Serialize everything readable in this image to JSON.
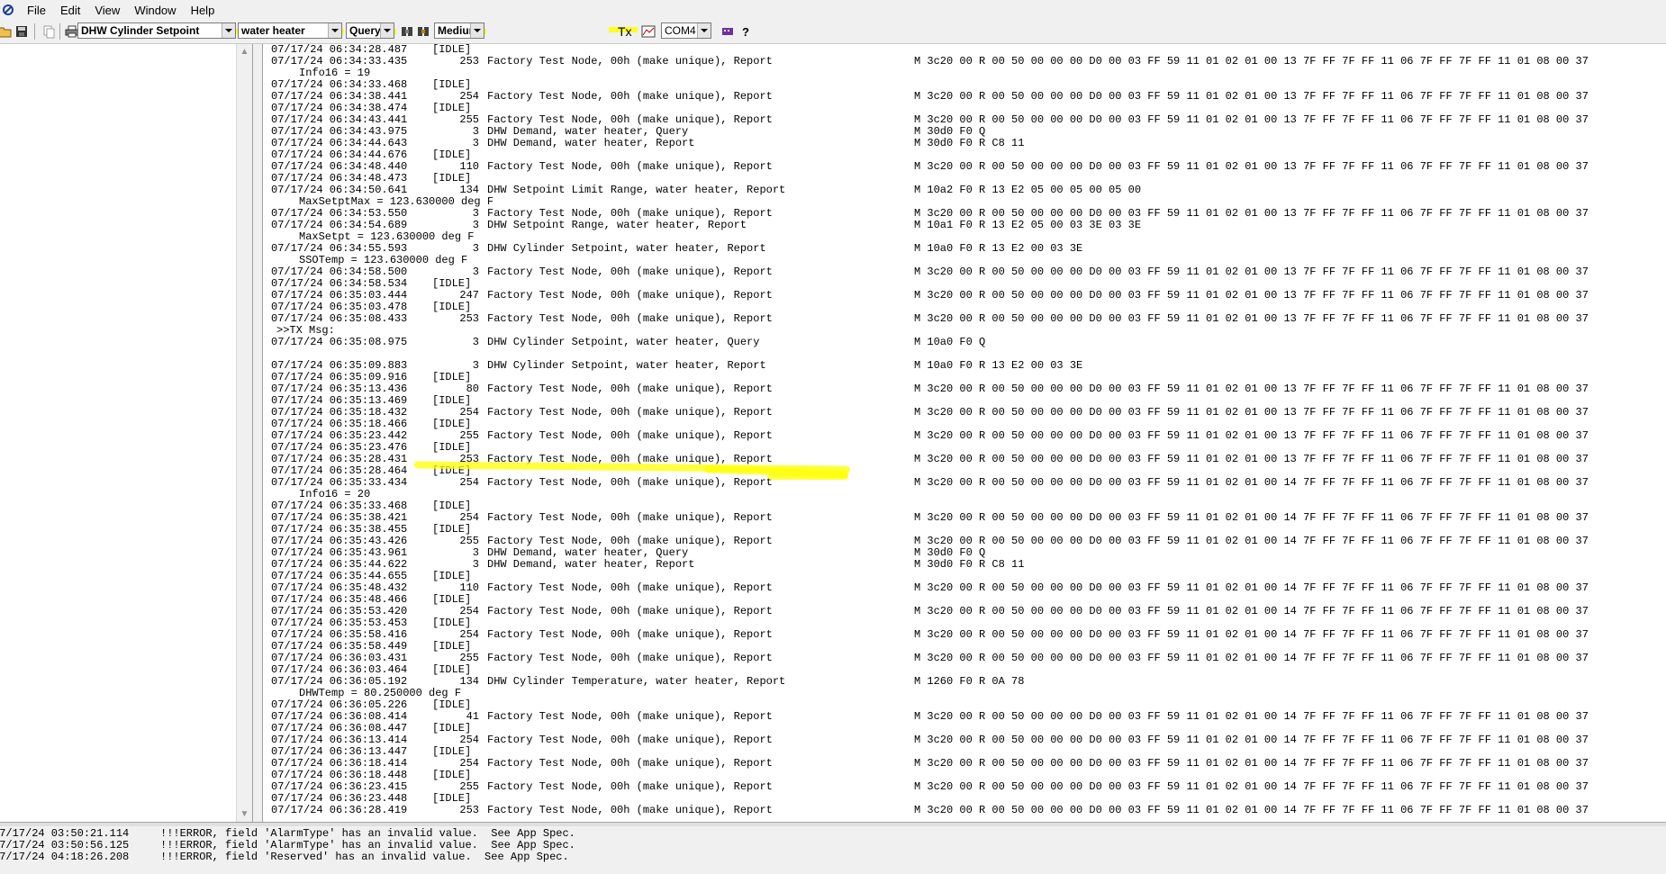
{
  "menu": [
    "File",
    "Edit",
    "View",
    "Window",
    "Help"
  ],
  "toolbar": {
    "combo_message": "DHW Cylinder Setpoint",
    "combo_device": "water heater",
    "combo_type": "Query",
    "combo_priority": "Medium",
    "tx_label": "Tx",
    "port": "COM4"
  },
  "log_lines": [
    {
      "ts": "07/17/24 06:34:28.487",
      "num": "",
      "desc": "[IDLE]",
      "hex": ""
    },
    {
      "ts": "07/17/24 06:34:33.435",
      "num": "253",
      "desc": "Factory Test Node, 00h (make unique), Report",
      "hex": "M 3c20 00 R 00 50 00 00 00 D0 00 03 FF 59 11 01 02 01 00 13 7F FF 7F FF 11 06 7F FF 7F FF 11 01 08 00 37"
    },
    {
      "sub": "Info16 = 19"
    },
    {
      "ts": "07/17/24 06:34:33.468",
      "num": "",
      "desc": "[IDLE]",
      "hex": ""
    },
    {
      "ts": "07/17/24 06:34:38.441",
      "num": "254",
      "desc": "Factory Test Node, 00h (make unique), Report",
      "hex": "M 3c20 00 R 00 50 00 00 00 D0 00 03 FF 59 11 01 02 01 00 13 7F FF 7F FF 11 06 7F FF 7F FF 11 01 08 00 37"
    },
    {
      "ts": "07/17/24 06:34:38.474",
      "num": "",
      "desc": "[IDLE]",
      "hex": ""
    },
    {
      "ts": "07/17/24 06:34:43.441",
      "num": "255",
      "desc": "Factory Test Node, 00h (make unique), Report",
      "hex": "M 3c20 00 R 00 50 00 00 00 D0 00 03 FF 59 11 01 02 01 00 13 7F FF 7F FF 11 06 7F FF 7F FF 11 01 08 00 37"
    },
    {
      "ts": "07/17/24 06:34:43.975",
      "num": "3",
      "desc": "DHW Demand, water heater, Query",
      "hex": "M 30d0 F0 Q"
    },
    {
      "ts": "07/17/24 06:34:44.643",
      "num": "3",
      "desc": "DHW Demand, water heater, Report",
      "hex": "M 30d0 F0 R C8 11"
    },
    {
      "ts": "07/17/24 06:34:44.676",
      "num": "",
      "desc": "[IDLE]",
      "hex": ""
    },
    {
      "ts": "07/17/24 06:34:48.440",
      "num": "110",
      "desc": "Factory Test Node, 00h (make unique), Report",
      "hex": "M 3c20 00 R 00 50 00 00 00 D0 00 03 FF 59 11 01 02 01 00 13 7F FF 7F FF 11 06 7F FF 7F FF 11 01 08 00 37"
    },
    {
      "ts": "07/17/24 06:34:48.473",
      "num": "",
      "desc": "[IDLE]",
      "hex": ""
    },
    {
      "ts": "07/17/24 06:34:50.641",
      "num": "134",
      "desc": "DHW Setpoint Limit Range, water heater, Report",
      "hex": "M 10a2 F0 R 13 E2 05 00 05 00 05 00"
    },
    {
      "sub": "MaxSetptMax = 123.630000 deg F"
    },
    {
      "ts": "07/17/24 06:34:53.550",
      "num": "3",
      "desc": "Factory Test Node, 00h (make unique), Report",
      "hex": "M 3c20 00 R 00 50 00 00 00 D0 00 03 FF 59 11 01 02 01 00 13 7F FF 7F FF 11 06 7F FF 7F FF 11 01 08 00 37"
    },
    {
      "ts": "07/17/24 06:34:54.689",
      "num": "3",
      "desc": "DHW Setpoint Range, water heater, Report",
      "hex": "M 10a1 F0 R 13 E2 05 00 03 3E 03 3E"
    },
    {
      "sub": "MaxSetpt = 123.630000 deg F"
    },
    {
      "ts": "07/17/24 06:34:55.593",
      "num": "3",
      "desc": "DHW Cylinder Setpoint, water heater, Report",
      "hex": "M 10a0 F0 R 13 E2 00 03 3E"
    },
    {
      "sub": "SSOTemp = 123.630000 deg F"
    },
    {
      "ts": "07/17/24 06:34:58.500",
      "num": "3",
      "desc": "Factory Test Node, 00h (make unique), Report",
      "hex": "M 3c20 00 R 00 50 00 00 00 D0 00 03 FF 59 11 01 02 01 00 13 7F FF 7F FF 11 06 7F FF 7F FF 11 01 08 00 37"
    },
    {
      "ts": "07/17/24 06:34:58.534",
      "num": "",
      "desc": "[IDLE]",
      "hex": ""
    },
    {
      "ts": "07/17/24 06:35:03.444",
      "num": "247",
      "desc": "Factory Test Node, 00h (make unique), Report",
      "hex": "M 3c20 00 R 00 50 00 00 00 D0 00 03 FF 59 11 01 02 01 00 13 7F FF 7F FF 11 06 7F FF 7F FF 11 01 08 00 37"
    },
    {
      "ts": "07/17/24 06:35:03.478",
      "num": "",
      "desc": "[IDLE]",
      "hex": ""
    },
    {
      "ts": "07/17/24 06:35:08.433",
      "num": "253",
      "desc": "Factory Test Node, 00h (make unique), Report",
      "hex": "M 3c20 00 R 00 50 00 00 00 D0 00 03 FF 59 11 01 02 01 00 13 7F FF 7F FF 11 06 7F FF 7F FF 11 01 08 00 37"
    },
    {
      "msg": ">>TX Msg:"
    },
    {
      "ts": "07/17/24 06:35:08.975",
      "num": "3",
      "desc": "DHW Cylinder Setpoint, water heater, Query",
      "hex": "M 10a0 F0 Q"
    },
    {
      "blank": true
    },
    {
      "ts": "07/17/24 06:35:09.883",
      "num": "3",
      "desc": "DHW Cylinder Setpoint, water heater, Report",
      "hex": "M 10a0 F0 R 13 E2 00 03 3E"
    },
    {
      "ts": "07/17/24 06:35:09.916",
      "num": "",
      "desc": "[IDLE]",
      "hex": ""
    },
    {
      "ts": "07/17/24 06:35:13.436",
      "num": "80",
      "desc": "Factory Test Node, 00h (make unique), Report",
      "hex": "M 3c20 00 R 00 50 00 00 00 D0 00 03 FF 59 11 01 02 01 00 13 7F FF 7F FF 11 06 7F FF 7F FF 11 01 08 00 37"
    },
    {
      "ts": "07/17/24 06:35:13.469",
      "num": "",
      "desc": "[IDLE]",
      "hex": ""
    },
    {
      "ts": "07/17/24 06:35:18.432",
      "num": "254",
      "desc": "Factory Test Node, 00h (make unique), Report",
      "hex": "M 3c20 00 R 00 50 00 00 00 D0 00 03 FF 59 11 01 02 01 00 13 7F FF 7F FF 11 06 7F FF 7F FF 11 01 08 00 37"
    },
    {
      "ts": "07/17/24 06:35:18.466",
      "num": "",
      "desc": "[IDLE]",
      "hex": ""
    },
    {
      "ts": "07/17/24 06:35:23.442",
      "num": "255",
      "desc": "Factory Test Node, 00h (make unique), Report",
      "hex": "M 3c20 00 R 00 50 00 00 00 D0 00 03 FF 59 11 01 02 01 00 13 7F FF 7F FF 11 06 7F FF 7F FF 11 01 08 00 37"
    },
    {
      "ts": "07/17/24 06:35:23.476",
      "num": "",
      "desc": "[IDLE]",
      "hex": ""
    },
    {
      "ts": "07/17/24 06:35:28.431",
      "num": "253",
      "desc": "Factory Test Node, 00h (make unique), Report",
      "hex": "M 3c20 00 R 00 50 00 00 00 D0 00 03 FF 59 11 01 02 01 00 13 7F FF 7F FF 11 06 7F FF 7F FF 11 01 08 00 37"
    },
    {
      "ts": "07/17/24 06:35:28.464",
      "num": "",
      "desc": "[IDLE]",
      "hex": ""
    },
    {
      "ts": "07/17/24 06:35:33.434",
      "num": "254",
      "desc": "Factory Test Node, 00h (make unique), Report",
      "hex": "M 3c20 00 R 00 50 00 00 00 D0 00 03 FF 59 11 01 02 01 00 14 7F FF 7F FF 11 06 7F FF 7F FF 11 01 08 00 37"
    },
    {
      "sub": "Info16 = 20"
    },
    {
      "ts": "07/17/24 06:35:33.468",
      "num": "",
      "desc": "[IDLE]",
      "hex": ""
    },
    {
      "ts": "07/17/24 06:35:38.421",
      "num": "254",
      "desc": "Factory Test Node, 00h (make unique), Report",
      "hex": "M 3c20 00 R 00 50 00 00 00 D0 00 03 FF 59 11 01 02 01 00 14 7F FF 7F FF 11 06 7F FF 7F FF 11 01 08 00 37"
    },
    {
      "ts": "07/17/24 06:35:38.455",
      "num": "",
      "desc": "[IDLE]",
      "hex": ""
    },
    {
      "ts": "07/17/24 06:35:43.426",
      "num": "255",
      "desc": "Factory Test Node, 00h (make unique), Report",
      "hex": "M 3c20 00 R 00 50 00 00 00 D0 00 03 FF 59 11 01 02 01 00 14 7F FF 7F FF 11 06 7F FF 7F FF 11 01 08 00 37"
    },
    {
      "ts": "07/17/24 06:35:43.961",
      "num": "3",
      "desc": "DHW Demand, water heater, Query",
      "hex": "M 30d0 F0 Q"
    },
    {
      "ts": "07/17/24 06:35:44.622",
      "num": "3",
      "desc": "DHW Demand, water heater, Report",
      "hex": "M 30d0 F0 R C8 11"
    },
    {
      "ts": "07/17/24 06:35:44.655",
      "num": "",
      "desc": "[IDLE]",
      "hex": ""
    },
    {
      "ts": "07/17/24 06:35:48.432",
      "num": "110",
      "desc": "Factory Test Node, 00h (make unique), Report",
      "hex": "M 3c20 00 R 00 50 00 00 00 D0 00 03 FF 59 11 01 02 01 00 14 7F FF 7F FF 11 06 7F FF 7F FF 11 01 08 00 37"
    },
    {
      "ts": "07/17/24 06:35:48.466",
      "num": "",
      "desc": "[IDLE]",
      "hex": ""
    },
    {
      "ts": "07/17/24 06:35:53.420",
      "num": "254",
      "desc": "Factory Test Node, 00h (make unique), Report",
      "hex": "M 3c20 00 R 00 50 00 00 00 D0 00 03 FF 59 11 01 02 01 00 14 7F FF 7F FF 11 06 7F FF 7F FF 11 01 08 00 37"
    },
    {
      "ts": "07/17/24 06:35:53.453",
      "num": "",
      "desc": "[IDLE]",
      "hex": ""
    },
    {
      "ts": "07/17/24 06:35:58.416",
      "num": "254",
      "desc": "Factory Test Node, 00h (make unique), Report",
      "hex": "M 3c20 00 R 00 50 00 00 00 D0 00 03 FF 59 11 01 02 01 00 14 7F FF 7F FF 11 06 7F FF 7F FF 11 01 08 00 37"
    },
    {
      "ts": "07/17/24 06:35:58.449",
      "num": "",
      "desc": "[IDLE]",
      "hex": ""
    },
    {
      "ts": "07/17/24 06:36:03.431",
      "num": "255",
      "desc": "Factory Test Node, 00h (make unique), Report",
      "hex": "M 3c20 00 R 00 50 00 00 00 D0 00 03 FF 59 11 01 02 01 00 14 7F FF 7F FF 11 06 7F FF 7F FF 11 01 08 00 37"
    },
    {
      "ts": "07/17/24 06:36:03.464",
      "num": "",
      "desc": "[IDLE]",
      "hex": ""
    },
    {
      "ts": "07/17/24 06:36:05.192",
      "num": "134",
      "desc": "DHW Cylinder Temperature, water heater, Report",
      "hex": "M 1260 F0 R 0A 78"
    },
    {
      "sub": "DHWTemp = 80.250000 deg F"
    },
    {
      "ts": "07/17/24 06:36:05.226",
      "num": "",
      "desc": "[IDLE]",
      "hex": ""
    },
    {
      "ts": "07/17/24 06:36:08.414",
      "num": "41",
      "desc": "Factory Test Node, 00h (make unique), Report",
      "hex": "M 3c20 00 R 00 50 00 00 00 D0 00 03 FF 59 11 01 02 01 00 14 7F FF 7F FF 11 06 7F FF 7F FF 11 01 08 00 37"
    },
    {
      "ts": "07/17/24 06:36:08.447",
      "num": "",
      "desc": "[IDLE]",
      "hex": ""
    },
    {
      "ts": "07/17/24 06:36:13.414",
      "num": "254",
      "desc": "Factory Test Node, 00h (make unique), Report",
      "hex": "M 3c20 00 R 00 50 00 00 00 D0 00 03 FF 59 11 01 02 01 00 14 7F FF 7F FF 11 06 7F FF 7F FF 11 01 08 00 37"
    },
    {
      "ts": "07/17/24 06:36:13.447",
      "num": "",
      "desc": "[IDLE]",
      "hex": ""
    },
    {
      "ts": "07/17/24 06:36:18.414",
      "num": "254",
      "desc": "Factory Test Node, 00h (make unique), Report",
      "hex": "M 3c20 00 R 00 50 00 00 00 D0 00 03 FF 59 11 01 02 01 00 14 7F FF 7F FF 11 06 7F FF 7F FF 11 01 08 00 37"
    },
    {
      "ts": "07/17/24 06:36:18.448",
      "num": "",
      "desc": "[IDLE]",
      "hex": ""
    },
    {
      "ts": "07/17/24 06:36:23.415",
      "num": "255",
      "desc": "Factory Test Node, 00h (make unique), Report",
      "hex": "M 3c20 00 R 00 50 00 00 00 D0 00 03 FF 59 11 01 02 01 00 14 7F FF 7F FF 11 06 7F FF 7F FF 11 01 08 00 37"
    },
    {
      "ts": "07/17/24 06:36:23.448",
      "num": "",
      "desc": "[IDLE]",
      "hex": ""
    },
    {
      "ts": "07/17/24 06:36:28.419",
      "num": "253",
      "desc": "Factory Test Node, 00h (make unique), Report",
      "hex": "M 3c20 00 R 00 50 00 00 00 D0 00 03 FF 59 11 01 02 01 00 14 7F FF 7F FF 11 06 7F FF 7F FF 11 01 08 00 37"
    }
  ],
  "error_lines": [
    {
      "ts": "07/17/24 03:50:21.114",
      "msg": "!!!ERROR, field 'AlarmType' has an invalid value.  See App Spec."
    },
    {
      "ts": "07/17/24 03:50:56.125",
      "msg": "!!!ERROR, field 'AlarmType' has an invalid value.  See App Spec."
    },
    {
      "ts": "07/17/24 04:18:26.208",
      "msg": "!!!ERROR, field 'Reserved' has an invalid value.  See App Spec."
    }
  ],
  "colors": {
    "highlight": "#ffff00",
    "menu_bg": "#f0f0f0",
    "log_bg": "#ffffff"
  },
  "icons": [
    "app-icon",
    "open-icon",
    "save-icon",
    "copy-icon",
    "print-icon",
    "filter-icon",
    "filter-toggle-icon",
    "graph-icon",
    "port-icon",
    "help-icon"
  ]
}
